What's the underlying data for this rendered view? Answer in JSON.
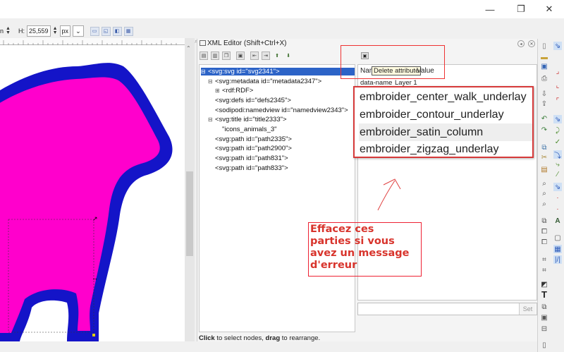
{
  "toolbar": {
    "h_label": "H:",
    "h_value": "25,559",
    "unit": "px",
    "w_value_tail": "n"
  },
  "xml_editor": {
    "title": "XML Editor (Shift+Ctrl+X)",
    "nodes": [
      {
        "text": "<svg:svg id=\"svg2341\">",
        "expander": "⊟",
        "selected": true
      },
      {
        "text": "<svg:metadata id=\"metadata2347\">",
        "expander": "⊟"
      },
      {
        "text": "<rdf:RDF>",
        "expander": "⊞"
      },
      {
        "text": "<svg:defs id=\"defs2345\">",
        "expander": ""
      },
      {
        "text": "<sodipodi:namedview id=\"namedview2343\">",
        "expander": ""
      },
      {
        "text": "<svg:title id=\"title2333\">",
        "expander": "⊟"
      },
      {
        "text": "\"icons_animals_3\"",
        "expander": ""
      },
      {
        "text": "<svg:path id=\"path2335\">",
        "expander": ""
      },
      {
        "text": "<svg:path id=\"path2900\">",
        "expander": ""
      },
      {
        "text": "<svg:path id=\"path831\">",
        "expander": ""
      },
      {
        "text": "<svg:path id=\"path833\">",
        "expander": ""
      }
    ],
    "attr_header_name": "Nar",
    "attr_header_value": "Value",
    "tooltip": "Delete attribute",
    "attr_row": {
      "name": "data-name",
      "value": "Layer 1"
    },
    "suggestions": [
      "embroider_center_walk_underlay",
      "embroider_contour_underlay",
      "embroider_satin_column",
      "embroider_zigzag_underlay"
    ],
    "highlighted_suggestion": 2,
    "set_label": "Set",
    "status_click": "Click",
    "status_mid": " to select nodes, ",
    "status_drag": "drag",
    "status_end": " to rearrange."
  },
  "annotation": {
    "note_lines": [
      "Effacez ces",
      "parties si vous",
      "avez un message",
      "d'erreur"
    ]
  },
  "window": {
    "minimize": "—",
    "maximize": "❐",
    "close": "✕"
  },
  "colors": {
    "accent": "#2c63c7",
    "annotation_red": "#d8342c",
    "shape_fill": "#ff00cc",
    "shape_outline": "#1414c8"
  }
}
